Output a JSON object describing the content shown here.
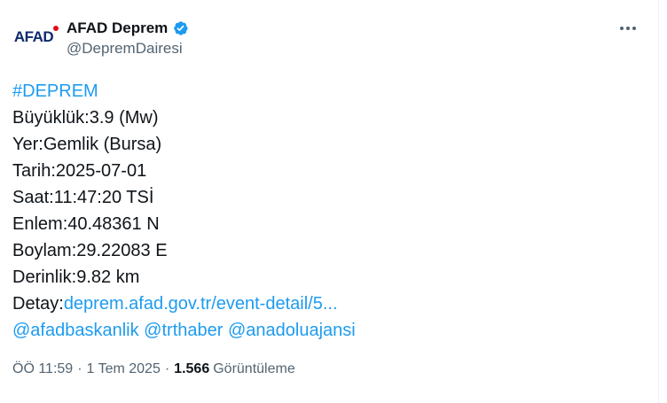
{
  "author": {
    "display_name": "AFAD Deprem",
    "handle": "@DepremDairesi",
    "avatar_text": "AFAD",
    "verified_icon": "verified-badge-icon",
    "verified_color": "#1d9bf0"
  },
  "tweet": {
    "hashtag": "#DEPREM",
    "lines": {
      "magnitude": "Büyüklük:3.9 (Mw)",
      "location": "Yer:Gemlik (Bursa)",
      "date": "Tarih:2025-07-01",
      "time": "Saat:11:47:20 TSİ",
      "latitude": "Enlem:40.48361 N",
      "longitude": "Boylam:29.22083 E",
      "depth": "Derinlik:9.82 km"
    },
    "detail_label": "Detay:",
    "detail_link": "deprem.afad.gov.tr/event-detail/5...",
    "mentions": [
      "@afadbaskanlik",
      "@trthaber",
      "@anadoluajansi"
    ]
  },
  "meta": {
    "time": "ÖÖ 11:59",
    "separator": "·",
    "date": "1 Tem 2025",
    "views_count": "1.566",
    "views_label": "Görüntüleme"
  },
  "colors": {
    "link": "#1d9bf0",
    "text": "#0f1419",
    "secondary": "#536471"
  }
}
